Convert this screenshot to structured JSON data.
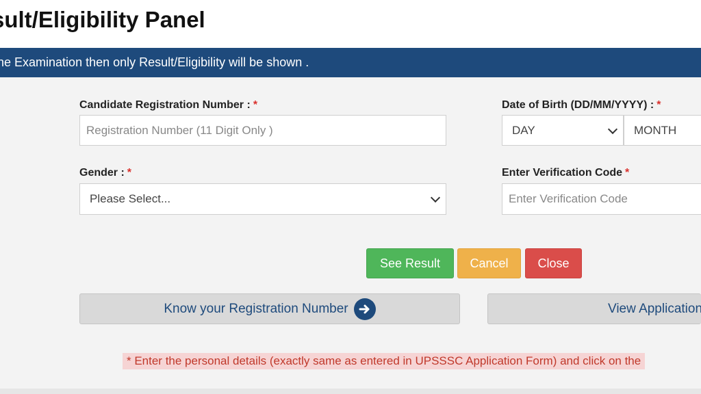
{
  "header": {
    "title": "sult/Eligibility Panel",
    "info": "the Examination then only Result/Eligibility will be shown ."
  },
  "form": {
    "registration": {
      "label": "Candidate Registration Number :",
      "required": "*",
      "placeholder": "Registration Number (11 Digit Only )"
    },
    "dob": {
      "label": "Date of Birth (DD/MM/YYYY) :",
      "required": "*",
      "day": "DAY",
      "month": "MONTH"
    },
    "gender": {
      "label": "Gender :",
      "required": "*",
      "selected": "Please Select..."
    },
    "verification": {
      "label": "Enter Verification Code",
      "required": "*",
      "placeholder": "Enter Verification Code"
    }
  },
  "buttons": {
    "see_result": "See Result",
    "cancel": "Cancel",
    "close": "Close",
    "know_registration": "Know your Registration Number",
    "view_application": "View Application"
  },
  "note": "* Enter the personal details (exactly same as entered in UPSSSC Application Form) and click on the",
  "colors": {
    "info_bar": "#1e4a7c",
    "see_result": "#4fb65a",
    "cancel": "#efb14a",
    "close": "#da4d4a",
    "required": "#d9302c"
  }
}
